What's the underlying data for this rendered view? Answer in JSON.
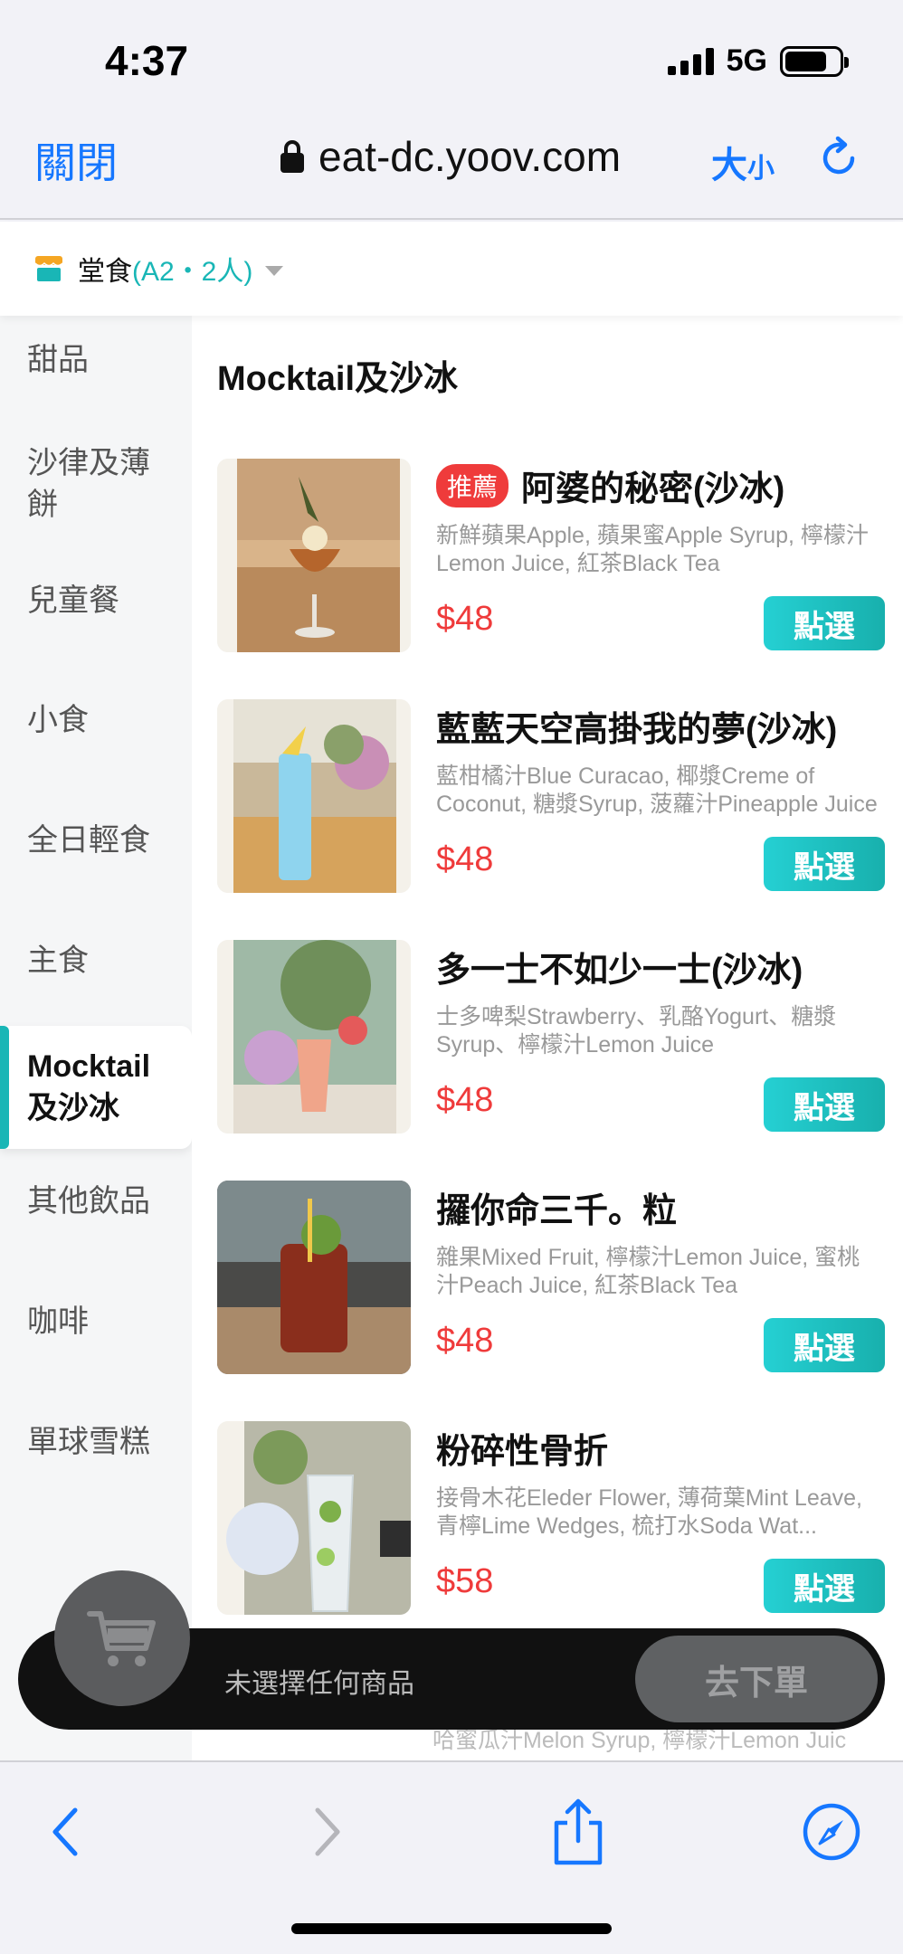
{
  "status_bar": {
    "time": "4:37",
    "network": "5G"
  },
  "browser": {
    "close_label": "關閉",
    "url": "eat-dc.yoov.com",
    "size_big": "大",
    "size_small": "小"
  },
  "dine": {
    "label": "堂食",
    "detail": "(A2・2人)"
  },
  "sidebar": {
    "items": [
      {
        "label": "甜品"
      },
      {
        "label": "沙律及薄餅"
      },
      {
        "label": "兒童餐"
      },
      {
        "label": "小食"
      },
      {
        "label": "全日輕食"
      },
      {
        "label": "主食"
      },
      {
        "label": "Mocktail及沙冰",
        "active": true
      },
      {
        "label": "其他飲品"
      },
      {
        "label": "咖啡"
      },
      {
        "label": "單球雪糕"
      }
    ]
  },
  "main": {
    "section_title": "Mocktail及沙冰",
    "order_label": "點選",
    "items": [
      {
        "badge": "推薦",
        "name": "阿婆的秘密(沙冰)",
        "desc": "新鮮蘋果Apple, 蘋果蜜Apple Syrup, 檸檬汁Lemon Juice, 紅茶Black Tea",
        "price": "$48"
      },
      {
        "name": "藍藍天空高掛我的夢(沙冰)",
        "desc": "藍柑橘汁Blue Curacao, 椰漿Creme of Coconut, 糖漿Syrup, 菠蘿汁Pineapple Juice",
        "price": "$48"
      },
      {
        "name": "多一士不如少一士(沙冰)",
        "desc": "士多啤梨Strawberry、乳酪Yogurt、糖漿Syrup、檸檬汁Lemon Juice",
        "price": "$48"
      },
      {
        "name": "攞你命三千。粒",
        "desc": "雜果Mixed Fruit, 檸檬汁Lemon Juice, 蜜桃汁Peach Juice, 紅茶Black Tea",
        "price": "$48"
      },
      {
        "name": "粉碎性骨折",
        "desc": "接骨木花Eleder Flower, 薄荷葉Mint Leave, 青檸Lime Wedges, 梳打水Soda Wat...",
        "price": "$58"
      }
    ],
    "peek_text": "哈蜜瓜汁Melon Syrup, 檸檬汁Lemon Juic"
  },
  "cart": {
    "empty_hint": "未選擇任何商品",
    "checkout_label": "去下單"
  },
  "colors": {
    "accent": "#19b6b6",
    "price": "#ef3b3b",
    "browser_blue": "#1677ff"
  },
  "icons": [
    "lock-icon",
    "reload-icon",
    "store-icon",
    "cart-icon",
    "back-icon",
    "forward-icon",
    "share-icon",
    "compass-icon"
  ]
}
